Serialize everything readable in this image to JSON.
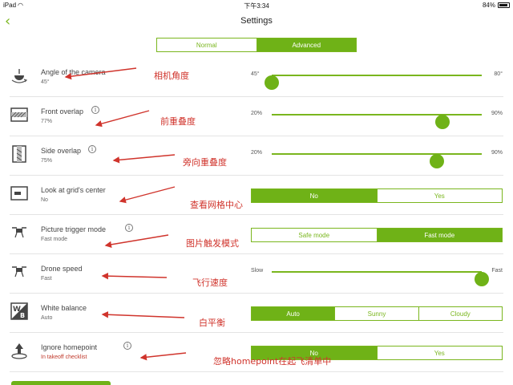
{
  "statusbar": {
    "device": "iPad",
    "time": "下午3:34",
    "battery": "84%"
  },
  "nav": {
    "title": "Settings"
  },
  "mode": {
    "options": [
      "Normal",
      "Advanced"
    ],
    "selected": 1
  },
  "rows": [
    {
      "id": "camera",
      "label": "Angle of the camera",
      "value": "45°",
      "control": "slider",
      "min": "45°",
      "max": "80°",
      "position": 0.0,
      "info": false,
      "annotation": "相机角度",
      "icon": "camera-gimbal-icon"
    },
    {
      "id": "front",
      "label": "Front overlap",
      "value": "77%",
      "control": "slider",
      "min": "20%",
      "max": "90%",
      "position": 0.814,
      "info": true,
      "annotation": "前重叠度",
      "icon": "front-overlap-icon"
    },
    {
      "id": "side",
      "label": "Side overlap",
      "value": "75%",
      "control": "slider",
      "min": "20%",
      "max": "90%",
      "position": 0.786,
      "info": true,
      "annotation": "旁向重叠度",
      "icon": "side-overlap-icon"
    },
    {
      "id": "grid",
      "label": "Look at grid's center",
      "value": "No",
      "control": "choice",
      "options": [
        "No",
        "Yes"
      ],
      "selected": 0,
      "info": false,
      "annotation": "查看网格中心",
      "icon": "grid-center-icon"
    },
    {
      "id": "trigger",
      "label": "Picture trigger mode",
      "value": "Fast mode",
      "control": "choice",
      "options": [
        "Safe mode",
        "Fast mode"
      ],
      "selected": 1,
      "info": true,
      "annotation": "图片触发模式",
      "icon": "drone-trigger-icon"
    },
    {
      "id": "speed",
      "label": "Drone speed",
      "value": "Fast",
      "control": "slider",
      "min": "Slow",
      "max": "Fast",
      "position": 1.0,
      "info": false,
      "annotation": "飞行速度",
      "icon": "drone-speed-icon"
    },
    {
      "id": "wb",
      "label": "White balance",
      "value": "Auto",
      "control": "choice",
      "options": [
        "Auto",
        "Sunny",
        "Cloudy"
      ],
      "selected": 0,
      "info": false,
      "annotation": "白平衡",
      "icon": "white-balance-icon"
    },
    {
      "id": "home",
      "label": "Ignore homepoint",
      "value": "In takeoff checklist",
      "control": "choice",
      "options": [
        "No",
        "Yes"
      ],
      "selected": 0,
      "info": true,
      "annotation": "忽略homepoint在起飞清单中",
      "icon": "homepoint-icon",
      "value_color": "#c0392b"
    }
  ],
  "colors": {
    "accent": "#6fb217",
    "annotation": "#d0342c"
  }
}
